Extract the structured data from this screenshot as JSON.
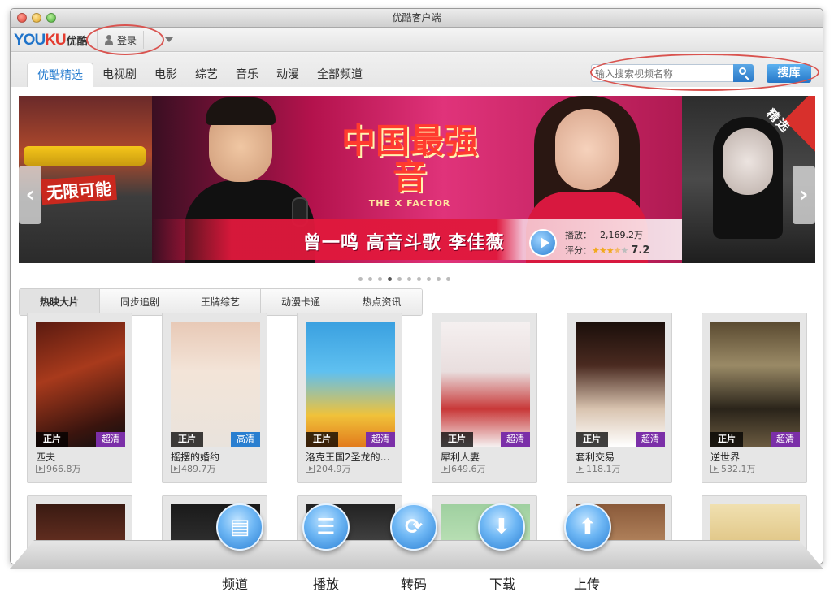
{
  "window": {
    "title": "优酷客户端"
  },
  "topbar": {
    "logo_text": "YOUKU",
    "logo_cn": "优酷",
    "login_label": "登录"
  },
  "nav": {
    "tabs": [
      {
        "label": "优酷精选",
        "active": true
      },
      {
        "label": "电视剧"
      },
      {
        "label": "电影"
      },
      {
        "label": "综艺"
      },
      {
        "label": "音乐"
      },
      {
        "label": "动漫"
      },
      {
        "label": "全部频道"
      }
    ],
    "search_placeholder": "输入搜索视频名称",
    "search_button": "搜库"
  },
  "banner": {
    "left_caption": "无限可能",
    "logo_big": "中国最强音",
    "logo_small": "THE X FACTOR",
    "slogan": "曾一鸣 高音斗歌 李佳薇",
    "play_label": "播放：",
    "play_value": "2,169.2万",
    "rating_label": "评分：",
    "rating_value": "7.2",
    "rating_stars": 3.5,
    "corner_tag": "精选",
    "dots_total": 10,
    "dots_active": 4
  },
  "subtabs": [
    {
      "label": "热映大片",
      "active": true
    },
    {
      "label": "同步追剧"
    },
    {
      "label": "王牌综艺"
    },
    {
      "label": "动漫卡通"
    },
    {
      "label": "热点资讯"
    }
  ],
  "movies": [
    {
      "title": "匹夫",
      "views": "966.8万",
      "type": "正片",
      "quality": "超清",
      "quality_color": "#7b2fa8"
    },
    {
      "title": "摇摆的婚约",
      "views": "489.7万",
      "type": "正片",
      "quality": "高清",
      "quality_color": "#2a7fd0"
    },
    {
      "title": "洛克王国2圣龙的…",
      "views": "204.9万",
      "type": "正片",
      "quality": "超清",
      "quality_color": "#7b2fa8"
    },
    {
      "title": "犀利人妻",
      "views": "649.6万",
      "type": "正片",
      "quality": "超清",
      "quality_color": "#7b2fa8"
    },
    {
      "title": "套利交易",
      "views": "118.1万",
      "type": "正片",
      "quality": "超清",
      "quality_color": "#7b2fa8"
    },
    {
      "title": "逆世界",
      "views": "532.1万",
      "type": "正片",
      "quality": "超清",
      "quality_color": "#7b2fa8"
    }
  ],
  "dock": [
    {
      "label": "频道",
      "icon": "film-icon"
    },
    {
      "label": "播放",
      "icon": "playlist-icon"
    },
    {
      "label": "转码",
      "icon": "convert-icon"
    },
    {
      "label": "下载",
      "icon": "download-icon"
    },
    {
      "label": "上传",
      "icon": "upload-icon"
    }
  ],
  "colors": {
    "accent": "#2b7fd0",
    "logo_blue": "#1f73c9",
    "logo_red": "#e33b2f",
    "annotation": "#d9534f"
  }
}
